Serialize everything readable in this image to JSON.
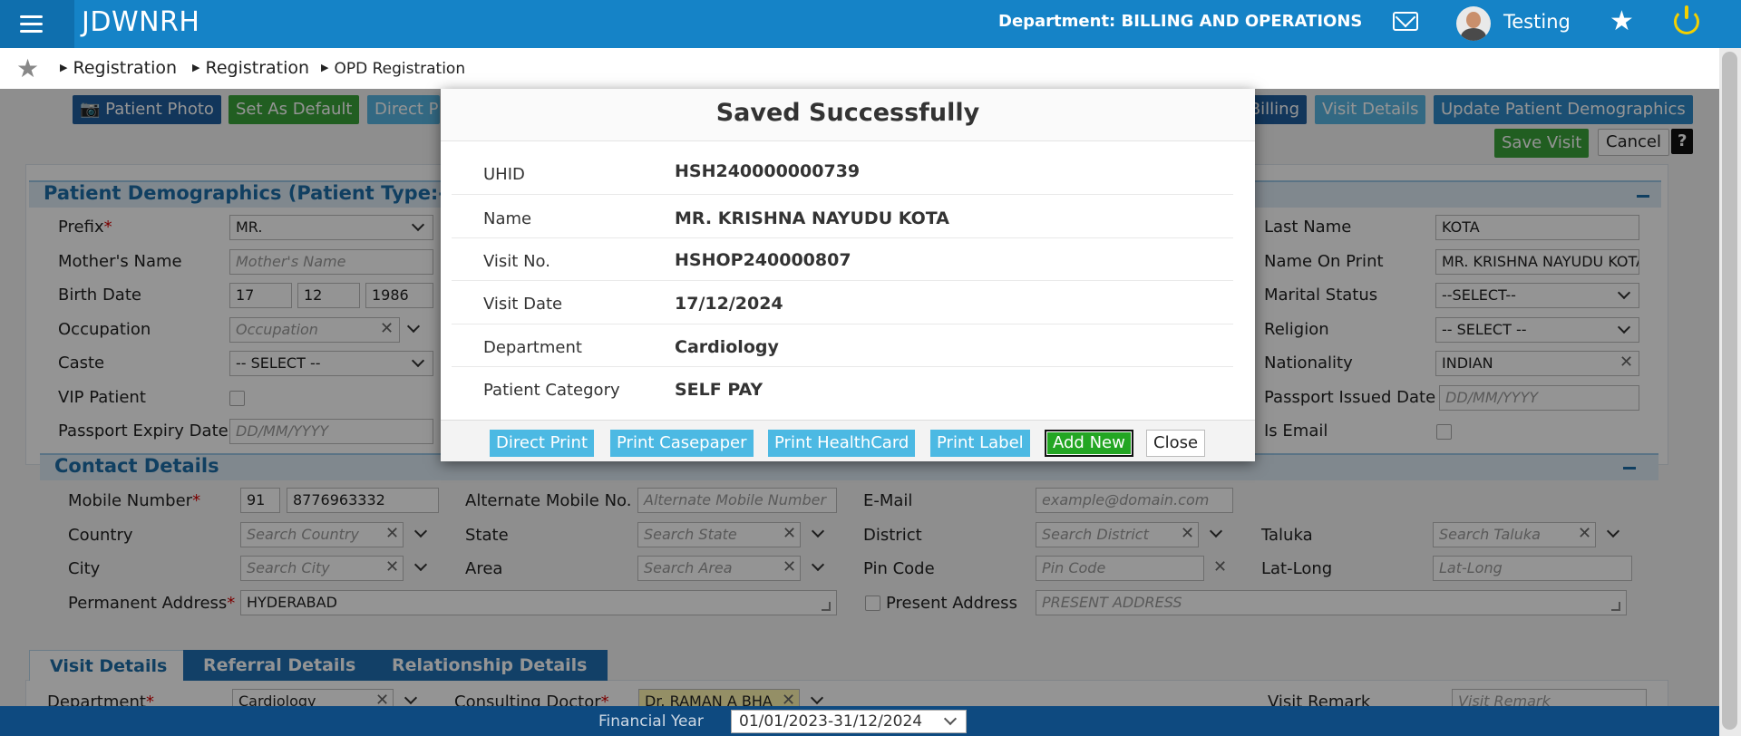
{
  "topbar": {
    "brand": "JDWNRH",
    "department": "Department: BILLING AND OPERATIONS",
    "user": "Testing"
  },
  "breadcrumb": [
    "Registration",
    "Registration",
    "OPD Registration"
  ],
  "toolbar": {
    "patient_photo": "Patient Photo",
    "set_default": "Set As Default",
    "direct": "Direct P",
    "billing": "Billing",
    "visit_details": "Visit Details",
    "update_demo": "Update Patient Demographics",
    "save_visit": "Save Visit",
    "cancel": "Cancel",
    "help": "?"
  },
  "demographics": {
    "title": "Patient Demographics (Patient Type:-)",
    "prefix_label": "Prefix",
    "prefix_value": "MR.",
    "mother_label": "Mother's Name",
    "mother_ph": "Mother's Name",
    "birth_label": "Birth Date",
    "birth_d": "17",
    "birth_m": "12",
    "birth_y": "1986",
    "occupation_label": "Occupation",
    "occupation_ph": "Occupation",
    "caste_label": "Caste",
    "caste_value": "-- SELECT --",
    "vip_label": "VIP Patient",
    "passport_exp_label": "Passport Expiry Date",
    "passport_exp_ph": "DD/MM/YYYY",
    "last_name_label": "Last Name",
    "last_name_value": "KOTA",
    "name_print_label": "Name On Print",
    "name_print_value": "MR. KRISHNA NAYUDU KOTA",
    "marital_label": "Marital Status",
    "marital_value": "--SELECT--",
    "religion_label": "Religion",
    "religion_value": "-- SELECT --",
    "nationality_label": "Nationality",
    "nationality_value": "INDIAN",
    "passport_iss_label": "Passport Issued Date",
    "passport_iss_ph": "DD/MM/YYYY",
    "is_email_label": "Is Email"
  },
  "contact": {
    "title": "Contact Details",
    "mobile_label": "Mobile Number",
    "mobile_code": "91",
    "mobile_value": "8776963332",
    "alt_mobile_label": "Alternate Mobile No.",
    "alt_mobile_ph": "Alternate Mobile Number",
    "email_label": "E-Mail",
    "email_ph": "example@domain.com",
    "country_label": "Country",
    "country_ph": "Search Country",
    "state_label": "State",
    "state_ph": "Search State",
    "district_label": "District",
    "district_ph": "Search District",
    "taluka_label": "Taluka",
    "taluka_ph": "Search Taluka",
    "city_label": "City",
    "city_ph": "Search City",
    "area_label": "Area",
    "area_ph": "Search Area",
    "pin_label": "Pin Code",
    "pin_ph": "Pin Code",
    "latlong_label": "Lat-Long",
    "latlong_ph": "Lat-Long",
    "perm_label": "Permanent Address",
    "perm_value": "HYDERABAD",
    "present_label": "Present Address",
    "present_ph": "PRESENT ADDRESS"
  },
  "tabs": [
    "Visit Details",
    "Referral Details",
    "Relationship Details"
  ],
  "visit": {
    "department_label": "Department",
    "department_value": "Cardiology",
    "doctor_label": "Consulting Doctor",
    "doctor_value": "Dr. RAMAN A BHA",
    "remark_label": "Visit Remark",
    "remark_ph": "Visit Remark"
  },
  "footer": {
    "label": "Financial Year",
    "value": "01/01/2023-31/12/2024"
  },
  "modal": {
    "title": "Saved Successfully",
    "rows": [
      {
        "key": "UHID",
        "value": "HSH240000000739"
      },
      {
        "key": "Name",
        "value": "MR. KRISHNA NAYUDU KOTA"
      },
      {
        "key": "Visit No.",
        "value": "HSHOP240000807"
      },
      {
        "key": "Visit Date",
        "value": "17/12/2024"
      },
      {
        "key": "Department",
        "value": "Cardiology"
      },
      {
        "key": "Patient Category",
        "value": "SELF PAY"
      }
    ],
    "buttons": {
      "direct_print": "Direct Print",
      "print_casepaper": "Print Casepaper",
      "print_healthcard": "Print HealthCard",
      "print_label": "Print Label",
      "add_new": "Add New",
      "close": "Close"
    }
  }
}
